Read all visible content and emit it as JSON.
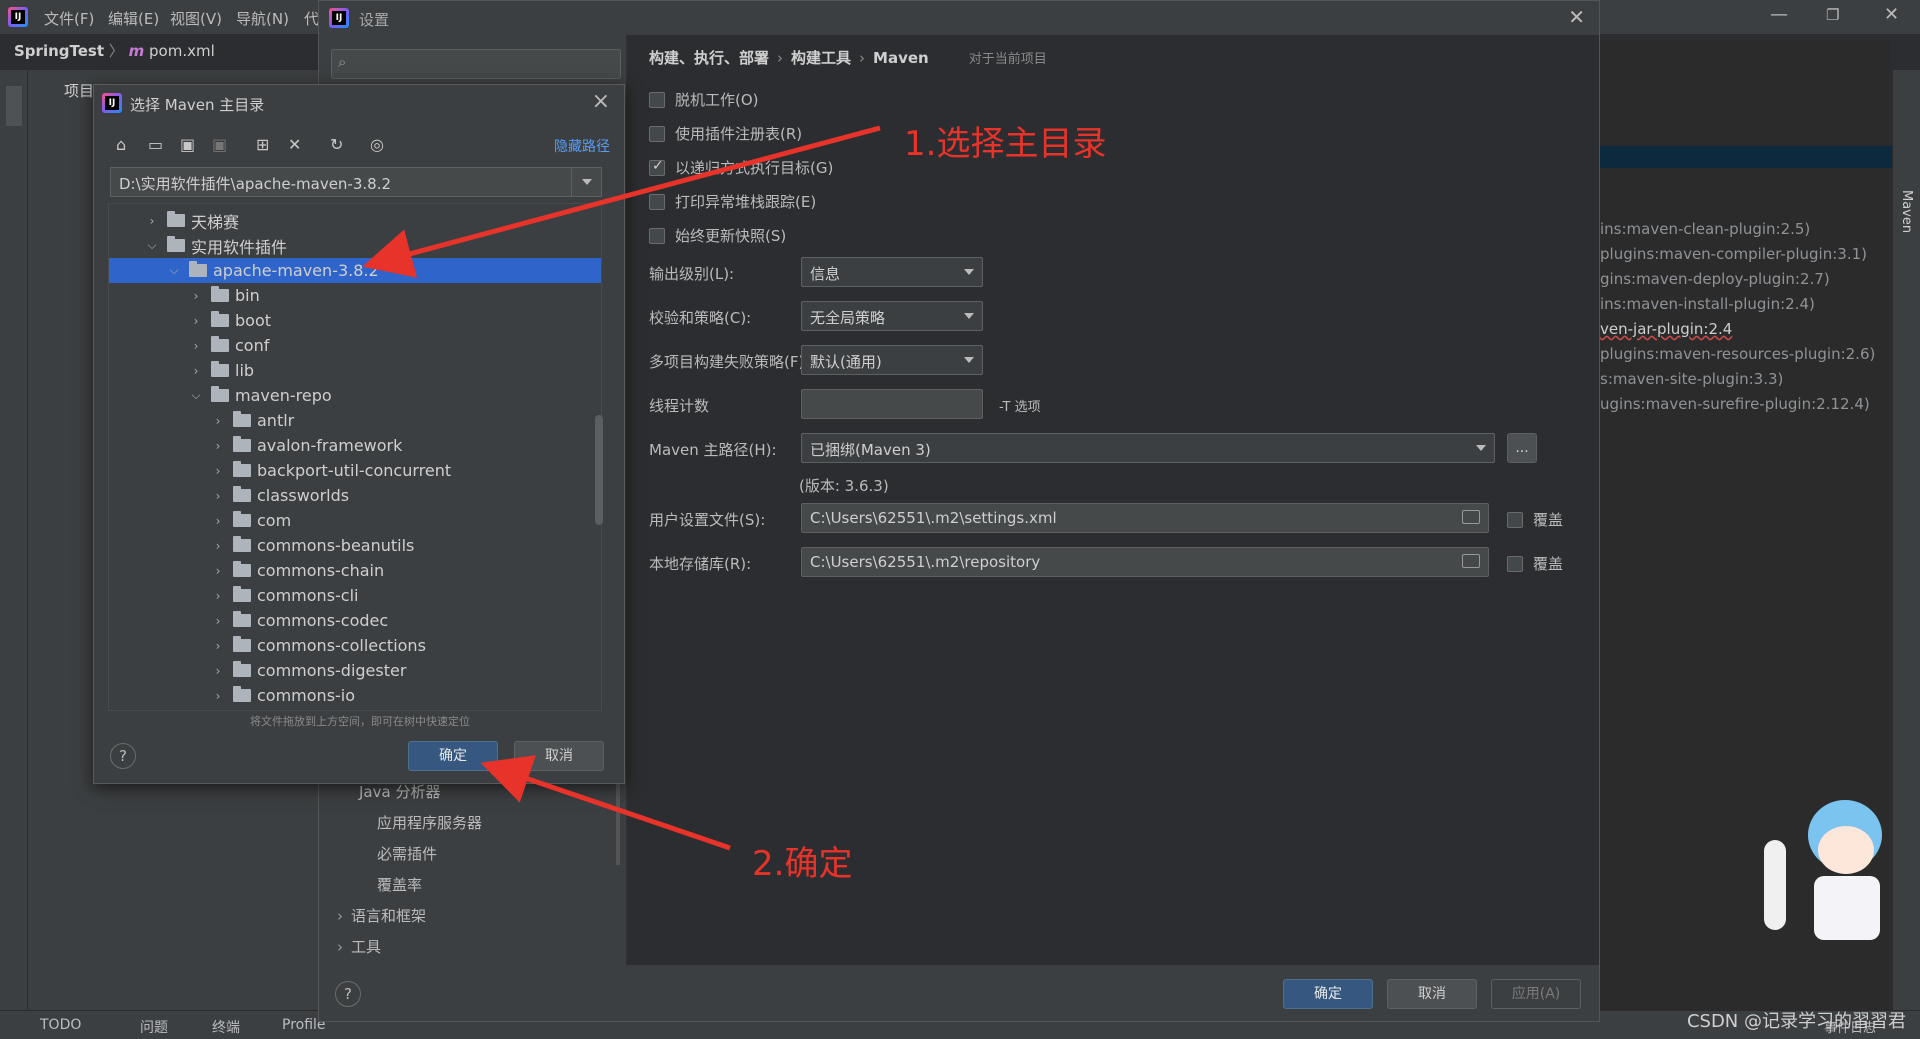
{
  "ide": {
    "menu": [
      "文件(F)",
      "编辑(E)",
      "视图(V)",
      "导航(N)",
      "代"
    ],
    "project": "SpringTest",
    "file": "pom.xml",
    "project_tab": "项目",
    "plugins": [
      "ins:maven-clean-plugin:2.5)",
      "plugins:maven-compiler-plugin:3.1)",
      "gins:maven-deploy-plugin:2.7)",
      "ins:maven-install-plugin:2.4)",
      "ven-jar-plugin:2.4",
      "plugins:maven-resources-plugin:2.6)",
      "s:maven-site-plugin:3.3)",
      "ugins:maven-surefire-plugin:2.12.4)"
    ],
    "status_items": [
      "TODO",
      "问题",
      "终端",
      "Profile"
    ],
    "event_log": "事件日志",
    "right_tab": "Maven"
  },
  "settings": {
    "title": "设置",
    "breadcrumb": [
      "构建、执行、部署",
      "构建工具",
      "Maven"
    ],
    "scope": "对于当前项目",
    "checkboxes": [
      {
        "label": "脱机工作(O)",
        "checked": false
      },
      {
        "label": "使用插件注册表(R)",
        "checked": false
      },
      {
        "label": "以递归方式执行目标(G)",
        "checked": true
      },
      {
        "label": "打印异常堆栈跟踪(E)",
        "checked": false
      },
      {
        "label": "始终更新快照(S)",
        "checked": false
      }
    ],
    "output_level_label": "输出级别(L):",
    "output_level_value": "信息",
    "checksum_label": "校验和策略(C):",
    "checksum_value": "无全局策略",
    "failure_label": "多项目构建失败策略(F):",
    "failure_value": "默认(通用)",
    "thread_label": "线程计数",
    "thread_value": "",
    "thread_hint": "-T 选项",
    "home_label": "Maven 主路径(H):",
    "home_value": "已捆绑(Maven 3)",
    "home_browse": "...",
    "version": "(版本: 3.6.3)",
    "user_settings_label": "用户设置文件(S):",
    "user_settings_value": "C:\\Users\\62551\\.m2\\settings.xml",
    "local_repo_label": "本地存储库(R):",
    "local_repo_value": "C:\\Users\\62551\\.m2\\repository",
    "override": "覆盖",
    "lower_items": [
      "Java 分析器",
      "应用程序服务器",
      "必需插件",
      "覆盖率",
      "语言和框架",
      "工具"
    ],
    "ok": "确定",
    "cancel": "取消",
    "apply": "应用(A)"
  },
  "chooser": {
    "title": "选择 Maven 主目录",
    "hide_path": "隐藏路径",
    "path": "D:\\实用软件插件\\apache-maven-3.8.2",
    "tree": [
      {
        "label": "天梯赛",
        "depth": 0,
        "expanded": false
      },
      {
        "label": "实用软件插件",
        "depth": 0,
        "expanded": true
      },
      {
        "label": "apache-maven-3.8.2",
        "depth": 1,
        "expanded": true,
        "selected": true
      },
      {
        "label": "bin",
        "depth": 2,
        "expanded": false
      },
      {
        "label": "boot",
        "depth": 2,
        "expanded": false
      },
      {
        "label": "conf",
        "depth": 2,
        "expanded": false
      },
      {
        "label": "lib",
        "depth": 2,
        "expanded": false
      },
      {
        "label": "maven-repo",
        "depth": 2,
        "expanded": true
      },
      {
        "label": "antlr",
        "depth": 3,
        "expanded": false
      },
      {
        "label": "avalon-framework",
        "depth": 3,
        "expanded": false
      },
      {
        "label": "backport-util-concurrent",
        "depth": 3,
        "expanded": false
      },
      {
        "label": "classworlds",
        "depth": 3,
        "expanded": false
      },
      {
        "label": "com",
        "depth": 3,
        "expanded": false
      },
      {
        "label": "commons-beanutils",
        "depth": 3,
        "expanded": false
      },
      {
        "label": "commons-chain",
        "depth": 3,
        "expanded": false
      },
      {
        "label": "commons-cli",
        "depth": 3,
        "expanded": false
      },
      {
        "label": "commons-codec",
        "depth": 3,
        "expanded": false
      },
      {
        "label": "commons-collections",
        "depth": 3,
        "expanded": false
      },
      {
        "label": "commons-digester",
        "depth": 3,
        "expanded": false
      },
      {
        "label": "commons-io",
        "depth": 3,
        "expanded": false
      }
    ],
    "hint": "将文件拖放到上方空间，即可在树中快速定位",
    "ok": "确定",
    "cancel": "取消"
  },
  "annotations": {
    "step1": "1.选择主目录",
    "step2": "2.确定",
    "color": "#e8332a"
  },
  "watermark": "CSDN @记录学习的習習君"
}
